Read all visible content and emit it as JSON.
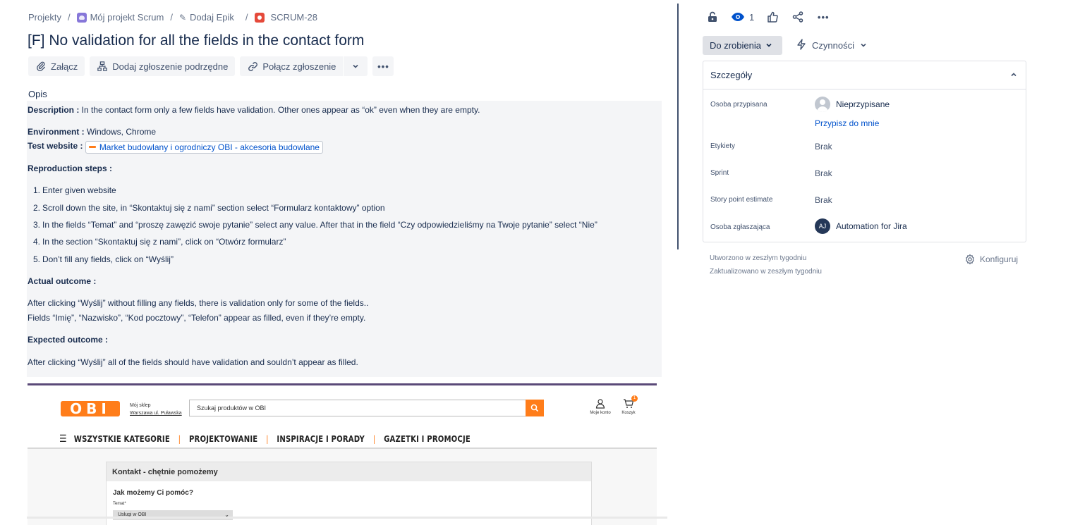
{
  "breadcrumb": {
    "projects": "Projekty",
    "project": "Mój projekt Scrum",
    "epic": "Dodaj Epik",
    "issue_key": "SCRUM-28"
  },
  "issue": {
    "title": "[F] No validation for all the fields in the contact form"
  },
  "toolbar": {
    "attach": "Załącz",
    "add_child": "Dodaj zgłoszenie podrzędne",
    "link_issue": "Połącz zgłoszenie"
  },
  "description": {
    "heading": "Opis",
    "desc_label": "Description :",
    "desc_text": " In the contact form only a few fields have validation. Other ones appear as “ok” even when they are empty.",
    "env_label": "Environment :",
    "env_text": " Windows, Chrome",
    "site_label": "Test website :",
    "site_link": "Market budowlany i ogrodniczy OBI - akcesoria budowlane",
    "steps_label": "Reproduction steps :",
    "steps": [
      "Enter given website",
      "Scroll down the site, in “Skontaktuj się z nami” section select “Formularz kontaktowy” option",
      "In the fields “Temat” and “proszę zawęzić swoje pytanie” select any value. After that in the field “Czy odpowiedzieliśmy na Twoje pytanie” select “Nie”",
      "In the section “Skontaktuj się z nami”, click on “Otwórz formularz”",
      "Don’t fill any fields, click on “Wyślij”"
    ],
    "actual_label": "Actual outcome :",
    "actual_1": "After clicking “Wyślij” without filling any fields, there is validation only for some of the fields..",
    "actual_2": "Fields “Imię”, “Nazwisko”, “Kod pocztowy”, “Telefon” appear as filled, even if they’re empty.",
    "expected_label": "Expected outcome :",
    "expected_text": "After clicking “Wyślij” all of the fields should have validation and souldn’t appear as filled."
  },
  "screenshot": {
    "logo": "OBI",
    "store_line1": "Mój sklep",
    "store_line2": "Warszawa ul. Puławska",
    "search_placeholder": "Szukaj produktów w OBI",
    "account": "Moje konto",
    "cart": "Koszyk",
    "cart_count": "1",
    "nav": [
      "WSZYSTKIE KATEGORIE",
      "PROJEKTOWANIE",
      "INSPIRACJE I PORADY",
      "GAZETKI I PROMOCJE"
    ],
    "panel_title": "Kontakt - chętnie pomożemy",
    "question": "Jak możemy Ci pomóc?",
    "topic_label": "Temat*",
    "topic_value": "Usługi w OBI"
  },
  "right": {
    "watchers": "1",
    "status": "Do zrobienia",
    "actions": "Czynności",
    "details_title": "Szczegóły",
    "assignee_label": "Osoba przypisana",
    "assignee_value": "Nieprzypisane",
    "assign_me": "Przypisz do mnie",
    "labels_label": "Etykiety",
    "labels_value": "Brak",
    "sprint_label": "Sprint",
    "sprint_value": "Brak",
    "sp_label": "Story point estimate",
    "sp_value": "Brak",
    "reporter_label": "Osoba zgłaszająca",
    "reporter_initials": "AJ",
    "reporter_value": "Automation for Jira",
    "created": "Utworzono w zeszłym tygodniu",
    "updated": "Zaktualizowano w zeszłym tygodniu",
    "configure": "Konfiguruj"
  },
  "colors": {
    "link": "#0052cc",
    "obi_orange": "#ff7d1a",
    "status_bg": "#dfe1e6"
  }
}
